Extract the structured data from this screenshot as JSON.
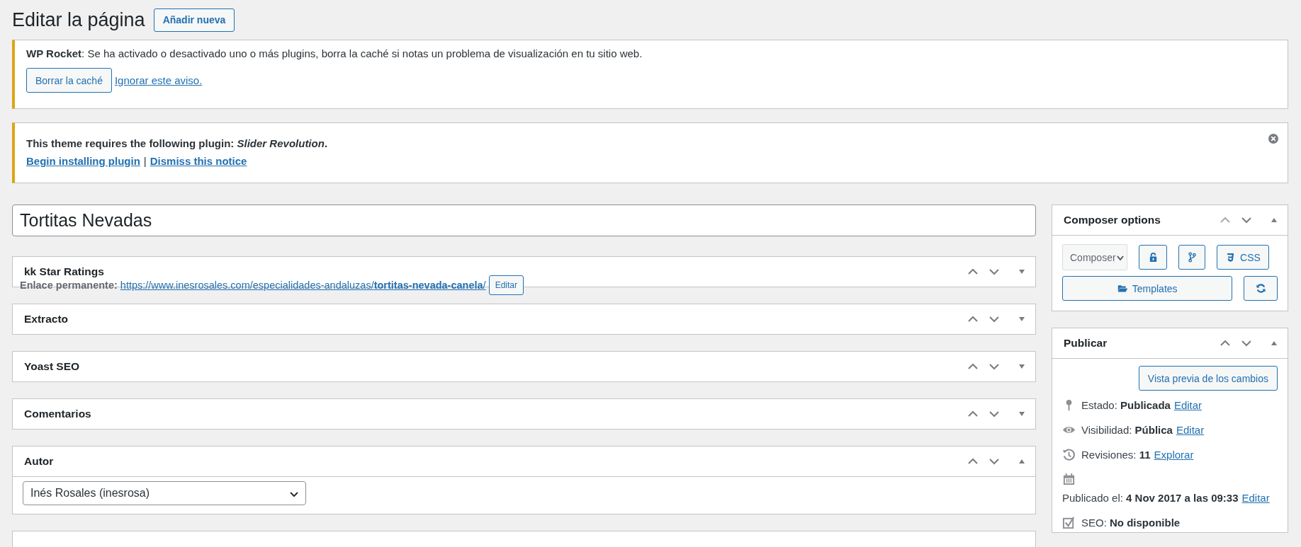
{
  "page_title": "Editar la página",
  "add_new_button": "Añadir nueva",
  "notices": [
    {
      "kind": "rocket",
      "message": "**WP Rocket**: Se ha activado o desactivado uno o más plugins, borra la caché si notas un problema de visualización en tu sitio web.",
      "button": "Borrar la caché",
      "link": "Ignorar este aviso.",
      "dismissible": false
    },
    {
      "kind": "plugin",
      "message": "This theme requires the following plugin: *Slider Revolution*.",
      "links": [
        "Begin installing plugin",
        "Dismiss this notice"
      ],
      "separator": "|",
      "dismissible": true
    }
  ],
  "title_field": {
    "value": "Tortitas Nevadas"
  },
  "permalink": {
    "label": "Enlace permanente:",
    "url_base": "https://www.inesrosales.com/especialidades-andaluzas/",
    "slug": "tortitas-nevada-canela",
    "url_end": "/",
    "button": "Editar"
  },
  "postboxes": [
    {
      "title": "kk Star Ratings",
      "expanded": false
    },
    {
      "title": "Extracto",
      "expanded": false
    },
    {
      "title": "Yoast SEO",
      "expanded": false
    },
    {
      "title": "Comentarios",
      "expanded": false
    },
    {
      "title": "Autor",
      "expanded": true,
      "select": "Inés Rosales (inesrosa)"
    }
  ],
  "composer_options": {
    "title": "Composer options",
    "expanded": true,
    "select": "Composer",
    "css_button": "CSS",
    "templates_button": "Templates"
  },
  "publish": {
    "title": "Publicar",
    "expanded": true,
    "preview_button": "Vista previa de los cambios",
    "rows": [
      {
        "kind": "pin",
        "label": "Estado:",
        "value": "Publicada",
        "link": "Editar"
      },
      {
        "kind": "eye",
        "label": "Visibilidad:",
        "value": "Pública",
        "link": "Editar"
      },
      {
        "kind": "history",
        "label": "Revisiones:",
        "value": "11",
        "link": "Explorar"
      },
      {
        "kind": "calendar",
        "label": "Publicado el:",
        "value": "4 Nov 2017 a las 09:33",
        "link": "Editar"
      },
      {
        "kind": "seo",
        "label": "SEO:",
        "value": "No disponible"
      }
    ]
  }
}
